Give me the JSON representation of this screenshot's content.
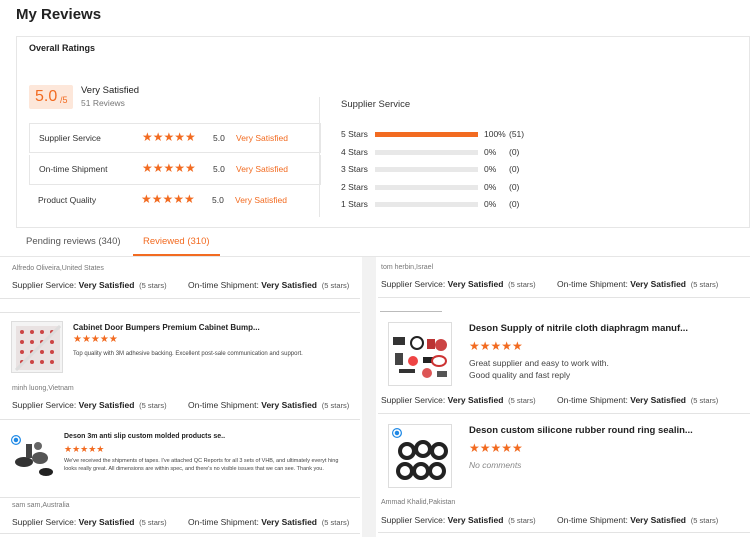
{
  "page": {
    "title": "My Reviews"
  },
  "overall": {
    "title": "Overall Ratings",
    "score": "5.0",
    "score_denominator": "/5",
    "summary_label": "Very Satisfied",
    "review_count": "51 Reviews"
  },
  "categories": [
    {
      "name": "Supplier Service",
      "stars": "★★★★★",
      "score": "5.0",
      "label": "Very Satisfied"
    },
    {
      "name": "On-time Shipment",
      "stars": "★★★★★",
      "score": "5.0",
      "label": "Very Satisfied"
    },
    {
      "name": "Product Quality",
      "stars": "★★★★★",
      "score": "5.0",
      "label": "Very Satisfied"
    }
  ],
  "breakdown": {
    "title": "Supplier Service",
    "rows": [
      {
        "label": "5 Stars",
        "fraction": 1.0,
        "pct": "100%",
        "count": "(51)"
      },
      {
        "label": "4 Stars",
        "fraction": 0,
        "pct": "0%",
        "count": "(0)"
      },
      {
        "label": "3 Stars",
        "fraction": 0,
        "pct": "0%",
        "count": "(0)"
      },
      {
        "label": "2 Stars",
        "fraction": 0,
        "pct": "0%",
        "count": "(0)"
      },
      {
        "label": "1 Stars",
        "fraction": 0,
        "pct": "0%",
        "count": "(0)"
      }
    ]
  },
  "tabs": {
    "pending": "Pending reviews (340)",
    "reviewed": "Reviewed (310)"
  },
  "service_labels": {
    "supplier": "Supplier Service:",
    "shipment": "On-time Shipment:",
    "value": "Very Satisfied",
    "stars_note": "(5 stars)"
  },
  "reviews_left": [
    {
      "reviewer": "Alfredo Oliveira,United States"
    },
    {
      "product": "Cabinet Door Bumpers Premium Cabinet Bump...",
      "stars": "★★★★★",
      "comment": "Top quality with 3M adhesive backing.  Excellent post-sale communication and support.",
      "reviewer": "minh luong,Vietnam"
    },
    {
      "product": "Deson 3m anti slip custom molded products se..",
      "stars": "★★★★★",
      "comment": "We've received the shipments of tapes. I've attached QC Reports for all 3 sets of VHB, and ultimately everyt hing looks really great. All dimensions are within spec, and there's no visible issues that we can see. Thank you.",
      "reviewer": "sam sam,Australia"
    }
  ],
  "reviews_right": [
    {
      "reviewer": "tom herbin,Israel"
    },
    {
      "product": "Deson Supply of nitrile cloth diaphragm manuf...",
      "stars": "★★★★★",
      "comment_line1": "Great supplier  and easy to work with.",
      "comment_line2": "Good quality and fast reply"
    },
    {
      "product": "Deson custom silicone rubber round ring sealin...",
      "stars": "★★★★★",
      "comment": "No comments",
      "reviewer": "Ammad Khalid,Pakistan"
    }
  ],
  "colors": {
    "accent": "#f26b21",
    "accent_light": "#fde7da"
  }
}
